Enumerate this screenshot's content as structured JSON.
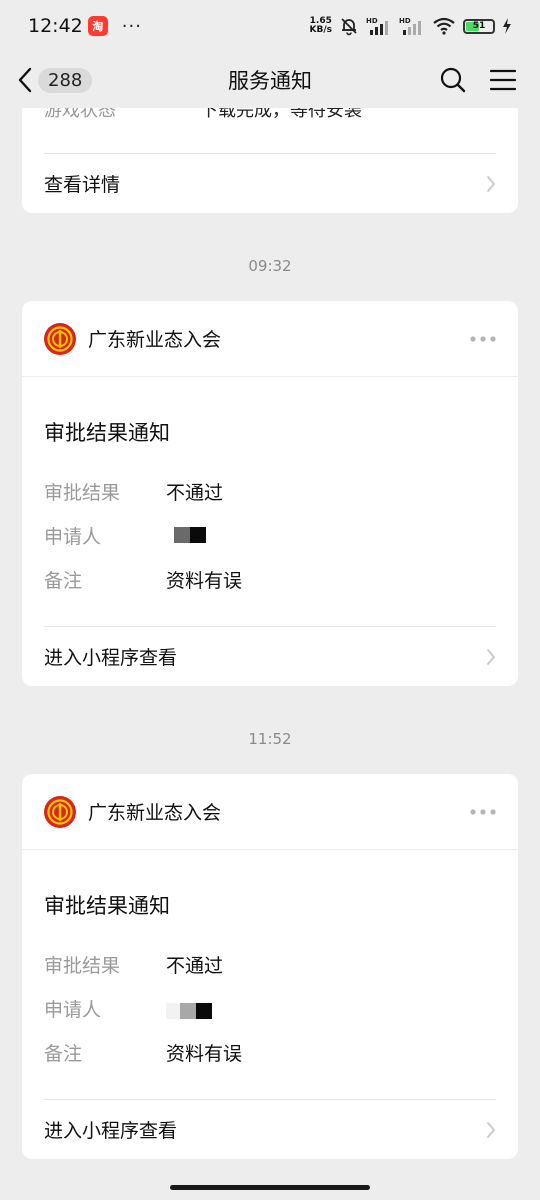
{
  "status_bar": {
    "time": "12:42",
    "app_badge": "淘",
    "dots": "···",
    "net_speed_value": "1.65",
    "net_speed_unit": "KB/s",
    "hd1": "HD",
    "hd2": "HD",
    "battery": "51"
  },
  "nav": {
    "unread_count": "288",
    "title": "服务通知"
  },
  "partial_card": {
    "label": "游戏状态",
    "value": "下载完成，等待安装",
    "link": "查看详情"
  },
  "messages": [
    {
      "time": "09:32",
      "org": "广东新业态入会",
      "title": "审批结果通知",
      "fields": [
        {
          "label": "审批结果",
          "value": "不通过"
        },
        {
          "label": "申请人",
          "value": ""
        },
        {
          "label": "备注",
          "value": "资料有误"
        }
      ],
      "link": "进入小程序查看"
    },
    {
      "time": "11:52",
      "org": "广东新业态入会",
      "title": "审批结果通知",
      "fields": [
        {
          "label": "审批结果",
          "value": "不通过"
        },
        {
          "label": "申请人",
          "value": ""
        },
        {
          "label": "备注",
          "value": "资料有误"
        }
      ],
      "link": "进入小程序查看"
    }
  ],
  "icons": {
    "back": "chevron-left-icon",
    "search": "search-icon",
    "menu": "menu-icon",
    "more": "more-dots-icon",
    "chevron": "chevron-right-icon",
    "logo": "union-logo-icon"
  },
  "colors": {
    "background": "#ededed",
    "card": "#ffffff",
    "logo_red": "#d9261c",
    "logo_yellow": "#f7c600",
    "battery_green": "#4cd964"
  }
}
